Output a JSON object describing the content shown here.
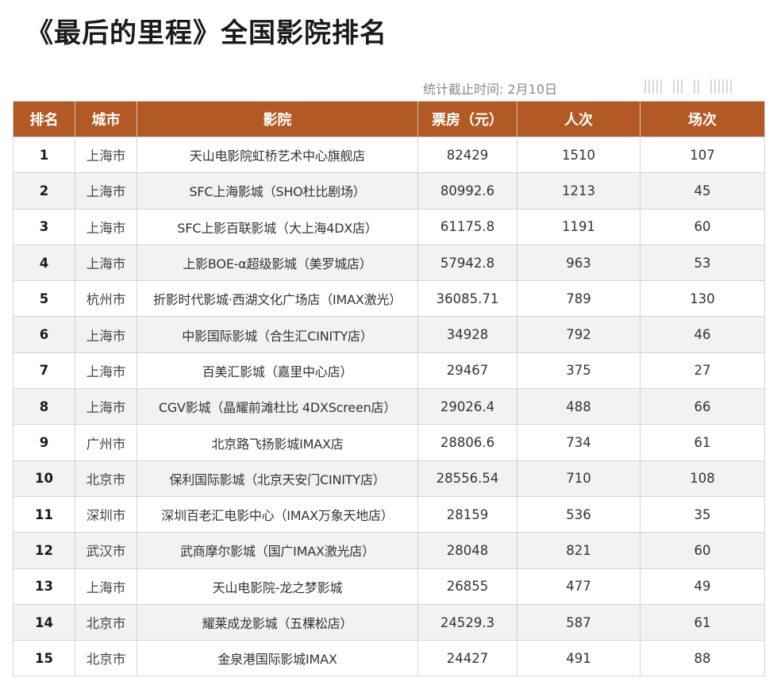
{
  "title": "《最后的里程》全国影院排名",
  "stats": {
    "label": "统计截止时间:",
    "date": "2月10日"
  },
  "table": {
    "headers": [
      "排名",
      "城市",
      "影院",
      "票房（元）",
      "人次",
      "场次"
    ],
    "rows": [
      {
        "rank": "1",
        "city": "上海市",
        "cinema": "天山电影院虹桥艺术中心旗舰店",
        "box_office": "82429",
        "admissions": "1510",
        "screenings": "107"
      },
      {
        "rank": "2",
        "city": "上海市",
        "cinema": "SFC上海影城（SHO杜比剧场）",
        "box_office": "80992.6",
        "admissions": "1213",
        "screenings": "45"
      },
      {
        "rank": "3",
        "city": "上海市",
        "cinema": "SFC上影百联影城（大上海4DX店）",
        "box_office": "61175.8",
        "admissions": "1191",
        "screenings": "60"
      },
      {
        "rank": "4",
        "city": "上海市",
        "cinema": "上影BOE-α超级影城（美罗城店）",
        "box_office": "57942.8",
        "admissions": "963",
        "screenings": "53"
      },
      {
        "rank": "5",
        "city": "杭州市",
        "cinema": "折影时代影城·西湖文化广场店（IMAX激光）",
        "box_office": "36085.71",
        "admissions": "789",
        "screenings": "130"
      },
      {
        "rank": "6",
        "city": "上海市",
        "cinema": "中影国际影城（合生汇CINITY店）",
        "box_office": "34928",
        "admissions": "792",
        "screenings": "46"
      },
      {
        "rank": "7",
        "city": "上海市",
        "cinema": "百美汇影城（嘉里中心店）",
        "box_office": "29467",
        "admissions": "375",
        "screenings": "27"
      },
      {
        "rank": "8",
        "city": "上海市",
        "cinema": "CGV影城（晶耀前滩杜比 4DXScreen店）",
        "box_office": "29026.4",
        "admissions": "488",
        "screenings": "66"
      },
      {
        "rank": "9",
        "city": "广州市",
        "cinema": "北京路飞扬影城IMAX店",
        "box_office": "28806.6",
        "admissions": "734",
        "screenings": "61"
      },
      {
        "rank": "10",
        "city": "北京市",
        "cinema": "保利国际影城（北京天安门CINITY店）",
        "box_office": "28556.54",
        "admissions": "710",
        "screenings": "108"
      },
      {
        "rank": "11",
        "city": "深圳市",
        "cinema": "深圳百老汇电影中心（IMAX万象天地店）",
        "box_office": "28159",
        "admissions": "536",
        "screenings": "35"
      },
      {
        "rank": "12",
        "city": "武汉市",
        "cinema": "武商摩尔影城（国广IMAX激光店）",
        "box_office": "28048",
        "admissions": "821",
        "screenings": "60"
      },
      {
        "rank": "13",
        "city": "上海市",
        "cinema": "天山电影院-龙之梦影城",
        "box_office": "26855",
        "admissions": "477",
        "screenings": "49"
      },
      {
        "rank": "14",
        "city": "北京市",
        "cinema": "耀莱成龙影城（五棵松店）",
        "box_office": "24529.3",
        "admissions": "587",
        "screenings": "61"
      },
      {
        "rank": "15",
        "city": "北京市",
        "cinema": "金泉港国际影城IMAX",
        "box_office": "24427",
        "admissions": "491",
        "screenings": "88"
      }
    ]
  }
}
